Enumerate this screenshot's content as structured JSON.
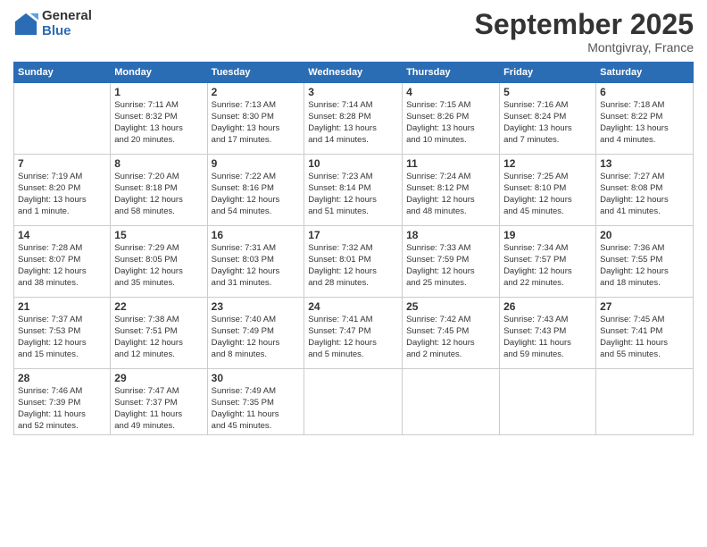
{
  "logo": {
    "general": "General",
    "blue": "Blue"
  },
  "title": "September 2025",
  "subtitle": "Montgivray, France",
  "days_header": [
    "Sunday",
    "Monday",
    "Tuesday",
    "Wednesday",
    "Thursday",
    "Friday",
    "Saturday"
  ],
  "weeks": [
    [
      {
        "num": "",
        "info": ""
      },
      {
        "num": "1",
        "info": "Sunrise: 7:11 AM\nSunset: 8:32 PM\nDaylight: 13 hours\nand 20 minutes."
      },
      {
        "num": "2",
        "info": "Sunrise: 7:13 AM\nSunset: 8:30 PM\nDaylight: 13 hours\nand 17 minutes."
      },
      {
        "num": "3",
        "info": "Sunrise: 7:14 AM\nSunset: 8:28 PM\nDaylight: 13 hours\nand 14 minutes."
      },
      {
        "num": "4",
        "info": "Sunrise: 7:15 AM\nSunset: 8:26 PM\nDaylight: 13 hours\nand 10 minutes."
      },
      {
        "num": "5",
        "info": "Sunrise: 7:16 AM\nSunset: 8:24 PM\nDaylight: 13 hours\nand 7 minutes."
      },
      {
        "num": "6",
        "info": "Sunrise: 7:18 AM\nSunset: 8:22 PM\nDaylight: 13 hours\nand 4 minutes."
      }
    ],
    [
      {
        "num": "7",
        "info": "Sunrise: 7:19 AM\nSunset: 8:20 PM\nDaylight: 13 hours\nand 1 minute."
      },
      {
        "num": "8",
        "info": "Sunrise: 7:20 AM\nSunset: 8:18 PM\nDaylight: 12 hours\nand 58 minutes."
      },
      {
        "num": "9",
        "info": "Sunrise: 7:22 AM\nSunset: 8:16 PM\nDaylight: 12 hours\nand 54 minutes."
      },
      {
        "num": "10",
        "info": "Sunrise: 7:23 AM\nSunset: 8:14 PM\nDaylight: 12 hours\nand 51 minutes."
      },
      {
        "num": "11",
        "info": "Sunrise: 7:24 AM\nSunset: 8:12 PM\nDaylight: 12 hours\nand 48 minutes."
      },
      {
        "num": "12",
        "info": "Sunrise: 7:25 AM\nSunset: 8:10 PM\nDaylight: 12 hours\nand 45 minutes."
      },
      {
        "num": "13",
        "info": "Sunrise: 7:27 AM\nSunset: 8:08 PM\nDaylight: 12 hours\nand 41 minutes."
      }
    ],
    [
      {
        "num": "14",
        "info": "Sunrise: 7:28 AM\nSunset: 8:07 PM\nDaylight: 12 hours\nand 38 minutes."
      },
      {
        "num": "15",
        "info": "Sunrise: 7:29 AM\nSunset: 8:05 PM\nDaylight: 12 hours\nand 35 minutes."
      },
      {
        "num": "16",
        "info": "Sunrise: 7:31 AM\nSunset: 8:03 PM\nDaylight: 12 hours\nand 31 minutes."
      },
      {
        "num": "17",
        "info": "Sunrise: 7:32 AM\nSunset: 8:01 PM\nDaylight: 12 hours\nand 28 minutes."
      },
      {
        "num": "18",
        "info": "Sunrise: 7:33 AM\nSunset: 7:59 PM\nDaylight: 12 hours\nand 25 minutes."
      },
      {
        "num": "19",
        "info": "Sunrise: 7:34 AM\nSunset: 7:57 PM\nDaylight: 12 hours\nand 22 minutes."
      },
      {
        "num": "20",
        "info": "Sunrise: 7:36 AM\nSunset: 7:55 PM\nDaylight: 12 hours\nand 18 minutes."
      }
    ],
    [
      {
        "num": "21",
        "info": "Sunrise: 7:37 AM\nSunset: 7:53 PM\nDaylight: 12 hours\nand 15 minutes."
      },
      {
        "num": "22",
        "info": "Sunrise: 7:38 AM\nSunset: 7:51 PM\nDaylight: 12 hours\nand 12 minutes."
      },
      {
        "num": "23",
        "info": "Sunrise: 7:40 AM\nSunset: 7:49 PM\nDaylight: 12 hours\nand 8 minutes."
      },
      {
        "num": "24",
        "info": "Sunrise: 7:41 AM\nSunset: 7:47 PM\nDaylight: 12 hours\nand 5 minutes."
      },
      {
        "num": "25",
        "info": "Sunrise: 7:42 AM\nSunset: 7:45 PM\nDaylight: 12 hours\nand 2 minutes."
      },
      {
        "num": "26",
        "info": "Sunrise: 7:43 AM\nSunset: 7:43 PM\nDaylight: 11 hours\nand 59 minutes."
      },
      {
        "num": "27",
        "info": "Sunrise: 7:45 AM\nSunset: 7:41 PM\nDaylight: 11 hours\nand 55 minutes."
      }
    ],
    [
      {
        "num": "28",
        "info": "Sunrise: 7:46 AM\nSunset: 7:39 PM\nDaylight: 11 hours\nand 52 minutes."
      },
      {
        "num": "29",
        "info": "Sunrise: 7:47 AM\nSunset: 7:37 PM\nDaylight: 11 hours\nand 49 minutes."
      },
      {
        "num": "30",
        "info": "Sunrise: 7:49 AM\nSunset: 7:35 PM\nDaylight: 11 hours\nand 45 minutes."
      },
      {
        "num": "",
        "info": ""
      },
      {
        "num": "",
        "info": ""
      },
      {
        "num": "",
        "info": ""
      },
      {
        "num": "",
        "info": ""
      }
    ]
  ]
}
